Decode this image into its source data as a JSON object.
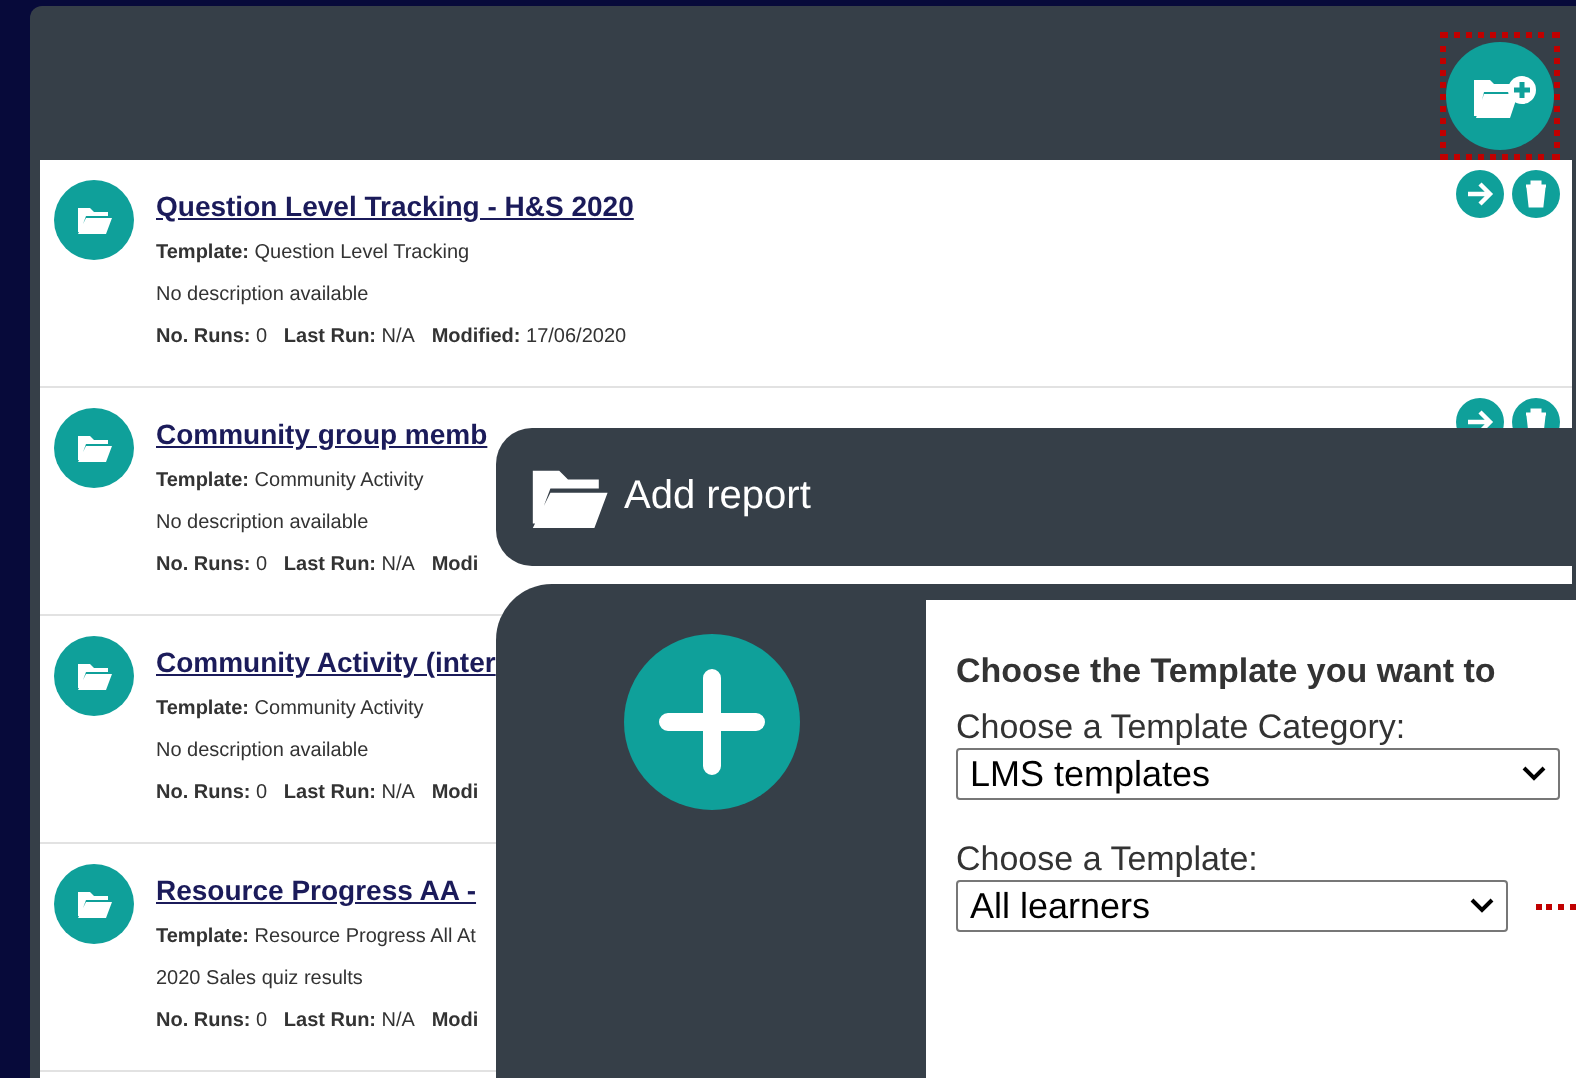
{
  "add_button": {
    "highlighted": true
  },
  "reports": [
    {
      "title": "Question Level Tracking - H&S 2020",
      "template_label": "Template:",
      "template": "Question Level Tracking",
      "description": "No description available",
      "runs_label": "No. Runs:",
      "runs": "0",
      "last_run_label": "Last Run:",
      "last_run": "N/A",
      "modified_label": "Modified:",
      "modified": "17/06/2020",
      "actions_visible": true
    },
    {
      "title": "Community group memb",
      "template_label": "Template:",
      "template": "Community Activity",
      "description": "No description available",
      "runs_label": "No. Runs:",
      "runs": "0",
      "last_run_label": "Last Run:",
      "last_run": "N/A",
      "modified_label": "Modi",
      "actions_visible": true
    },
    {
      "title": "Community Activity (inter",
      "template_label": "Template:",
      "template": "Community Activity",
      "description": "No description available",
      "runs_label": "No. Runs:",
      "runs": "0",
      "last_run_label": "Last Run:",
      "last_run": "N/A",
      "modified_label": "Modi"
    },
    {
      "title": "Resource Progress AA -",
      "template_label": "Template:",
      "template": "Resource Progress All At",
      "description": "2020 Sales quiz results",
      "runs_label": "No. Runs:",
      "runs": "0",
      "last_run_label": "Last Run:",
      "last_run": "N/A",
      "modified_label": "Modi"
    }
  ],
  "dialog": {
    "title": "Add report",
    "heading": "Choose the Template you want to",
    "category_label": "Choose a Template Category:",
    "category_value": "LMS templates",
    "template_label": "Choose a Template:",
    "template_value": "All learners",
    "template_highlighted": true
  }
}
